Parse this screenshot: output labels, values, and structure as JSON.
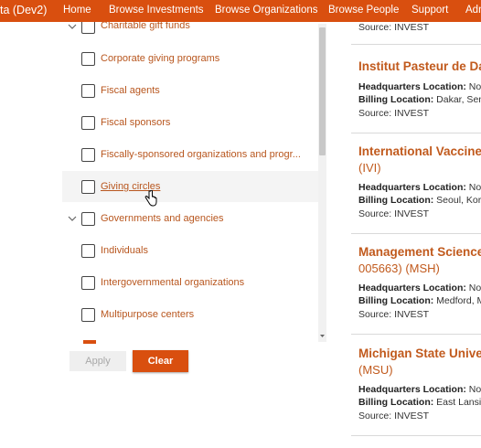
{
  "topbar": {
    "brand": "ta (Dev2)",
    "nav": [
      "Home",
      "Browse Investments",
      "Browse Organizations",
      "Browse People",
      "Support",
      "Adm"
    ]
  },
  "filters": {
    "items": [
      {
        "label": "Charitable gift funds",
        "checked": false
      },
      {
        "label": "Corporate giving programs",
        "checked": false
      },
      {
        "label": "Fiscal agents",
        "checked": false
      },
      {
        "label": "Fiscal sponsors",
        "checked": false
      },
      {
        "label": "Fiscally-sponsored organizations and progr...",
        "checked": false
      },
      {
        "label": "Giving circles",
        "checked": false
      },
      {
        "label": "Governments and agencies",
        "checked": false
      },
      {
        "label": "Individuals",
        "checked": false
      },
      {
        "label": "Intergovernmental organizations",
        "checked": false
      },
      {
        "label": "Multipurpose centers",
        "checked": false
      }
    ],
    "apply_label": "Apply",
    "clear_label": "Clear"
  },
  "results": {
    "top_source": "Source: INVEST",
    "hq_label": "Headquarters Location:",
    "billing_label": "Billing Location:",
    "cards": [
      {
        "title": "Institut Pasteur de Da",
        "sub": "",
        "hq": "No c",
        "billing": "Dakar, Sene",
        "source": "Source: INVEST"
      },
      {
        "title": "International Vaccine",
        "sub": "(IVI)",
        "hq": "No c",
        "billing": "Seoul, Korea",
        "source": "Source: INVEST"
      },
      {
        "title": "Management Science",
        "sub": "005663) (MSH)",
        "hq": "No c",
        "billing": "Medford, M",
        "source": "Source: INVEST"
      },
      {
        "title": "Michigan State Univer",
        "sub": "(MSU)",
        "hq": "No c",
        "billing": "East Lansing",
        "source": "Source: INVEST"
      }
    ]
  },
  "colors": {
    "brand": "#d94f0f",
    "link": "#c15a1d"
  }
}
